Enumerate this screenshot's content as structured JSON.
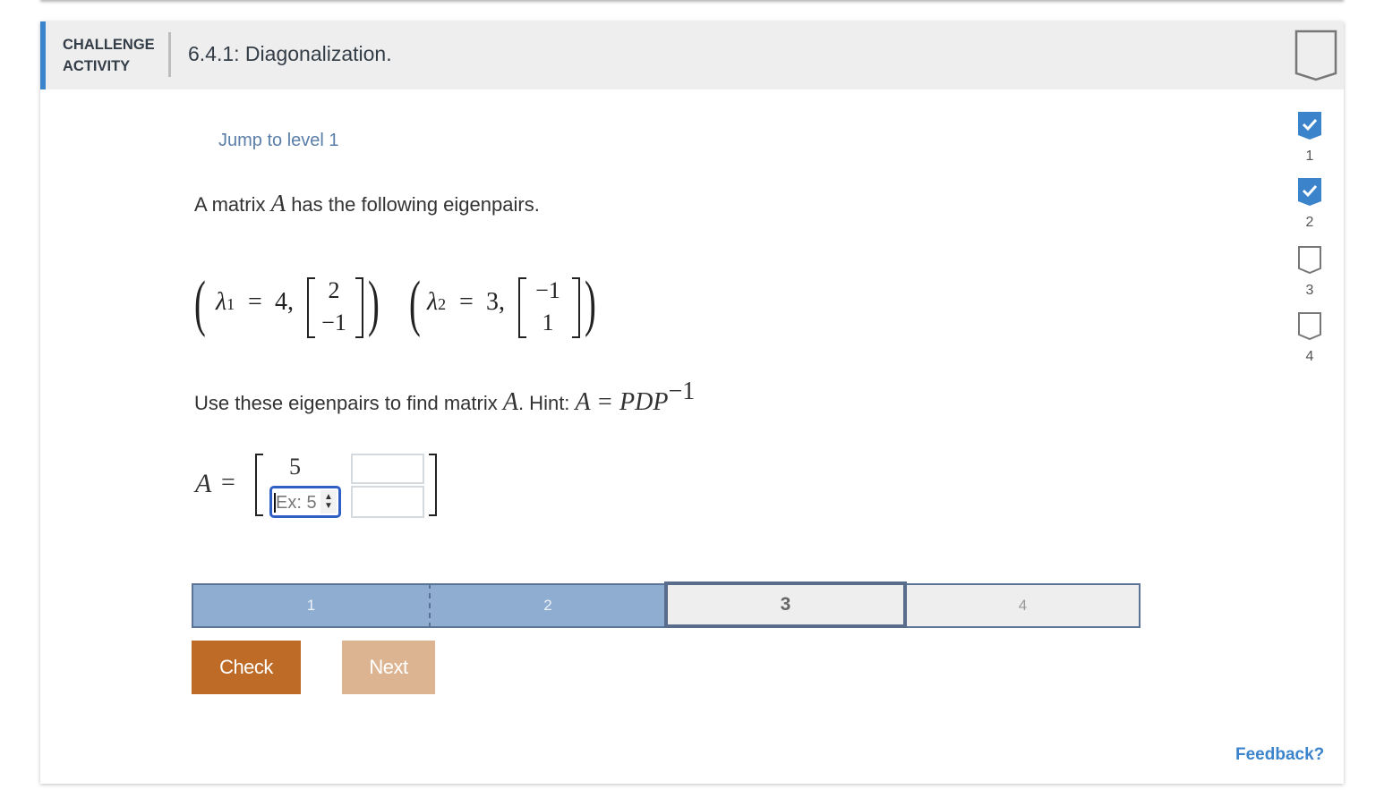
{
  "header": {
    "kind_line1": "CHALLENGE",
    "kind_line2": "ACTIVITY",
    "title": "6.4.1: Diagonalization.",
    "bookmark_icon": "bookmark-outline-icon"
  },
  "problem": {
    "jump_link": "Jump to level 1",
    "prompt_pre": "A matrix ",
    "prompt_var": "A",
    "prompt_post": " has the following eigenpairs.",
    "eigenpairs": [
      {
        "lambda": "λ",
        "sub": "1",
        "value": "4,",
        "vector": [
          "2",
          "−1"
        ]
      },
      {
        "lambda": "λ",
        "sub": "2",
        "value": "3,",
        "vector": [
          "−1",
          "1"
        ]
      }
    ],
    "use_text": "Use these eigenpairs to find matrix ",
    "use_var": "A",
    "hint_label": ". Hint: ",
    "hint_formula": "A = PDP",
    "hint_sup": "−1"
  },
  "answer": {
    "lhs": "A",
    "eq": "=",
    "a11": "5",
    "a21_placeholder": "Ex: 5",
    "a12_value": "",
    "a22_value": ""
  },
  "levels": {
    "items": [
      {
        "label": "1",
        "state": "done"
      },
      {
        "label": "2",
        "state": "done"
      },
      {
        "label": "3",
        "state": "current"
      },
      {
        "label": "4",
        "state": "locked"
      }
    ]
  },
  "buttons": {
    "check": "Check",
    "next": "Next"
  },
  "feedback": "Feedback?",
  "sidebar": {
    "items": [
      {
        "label": "1",
        "completed": true
      },
      {
        "label": "2",
        "completed": true
      },
      {
        "label": "3",
        "completed": false
      },
      {
        "label": "4",
        "completed": false
      }
    ]
  },
  "colors": {
    "accent_blue": "#3b84cc",
    "check_button": "#bd6b27",
    "next_button_disabled": "#ddb492",
    "level_done": "#8fadd1",
    "level_border": "#5a7396",
    "link": "#5a7ea8"
  }
}
